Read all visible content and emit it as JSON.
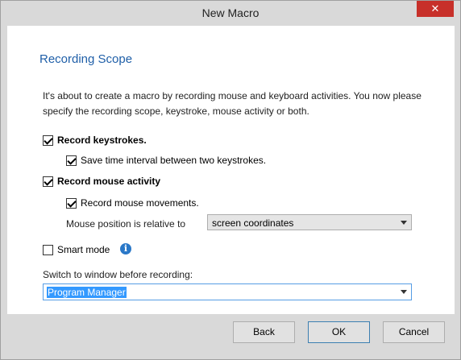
{
  "window": {
    "title": "New Macro",
    "close_glyph": "✕"
  },
  "page": {
    "heading": "Recording Scope",
    "description": "It's about to create a macro by recording mouse and keyboard activities. You now please specify the recording scope, keystroke, mouse activity or both."
  },
  "options": {
    "record_keystrokes": {
      "label": "Record keystrokes.",
      "checked": true
    },
    "save_time_interval": {
      "label": "Save time interval between two keystrokes.",
      "checked": true
    },
    "record_mouse_activity": {
      "label": "Record mouse activity",
      "checked": true
    },
    "record_mouse_movements": {
      "label": "Record mouse movements.",
      "checked": true
    },
    "mouse_position_label": "Mouse position is relative to",
    "mouse_position_value": "screen coordinates",
    "smart_mode": {
      "label": "Smart mode",
      "checked": false,
      "info_icon": "info-icon"
    },
    "switch_window_label": "Switch to window before recording:",
    "switch_window_value": "Program Manager"
  },
  "buttons": {
    "back": "Back",
    "ok": "OK",
    "cancel": "Cancel"
  }
}
